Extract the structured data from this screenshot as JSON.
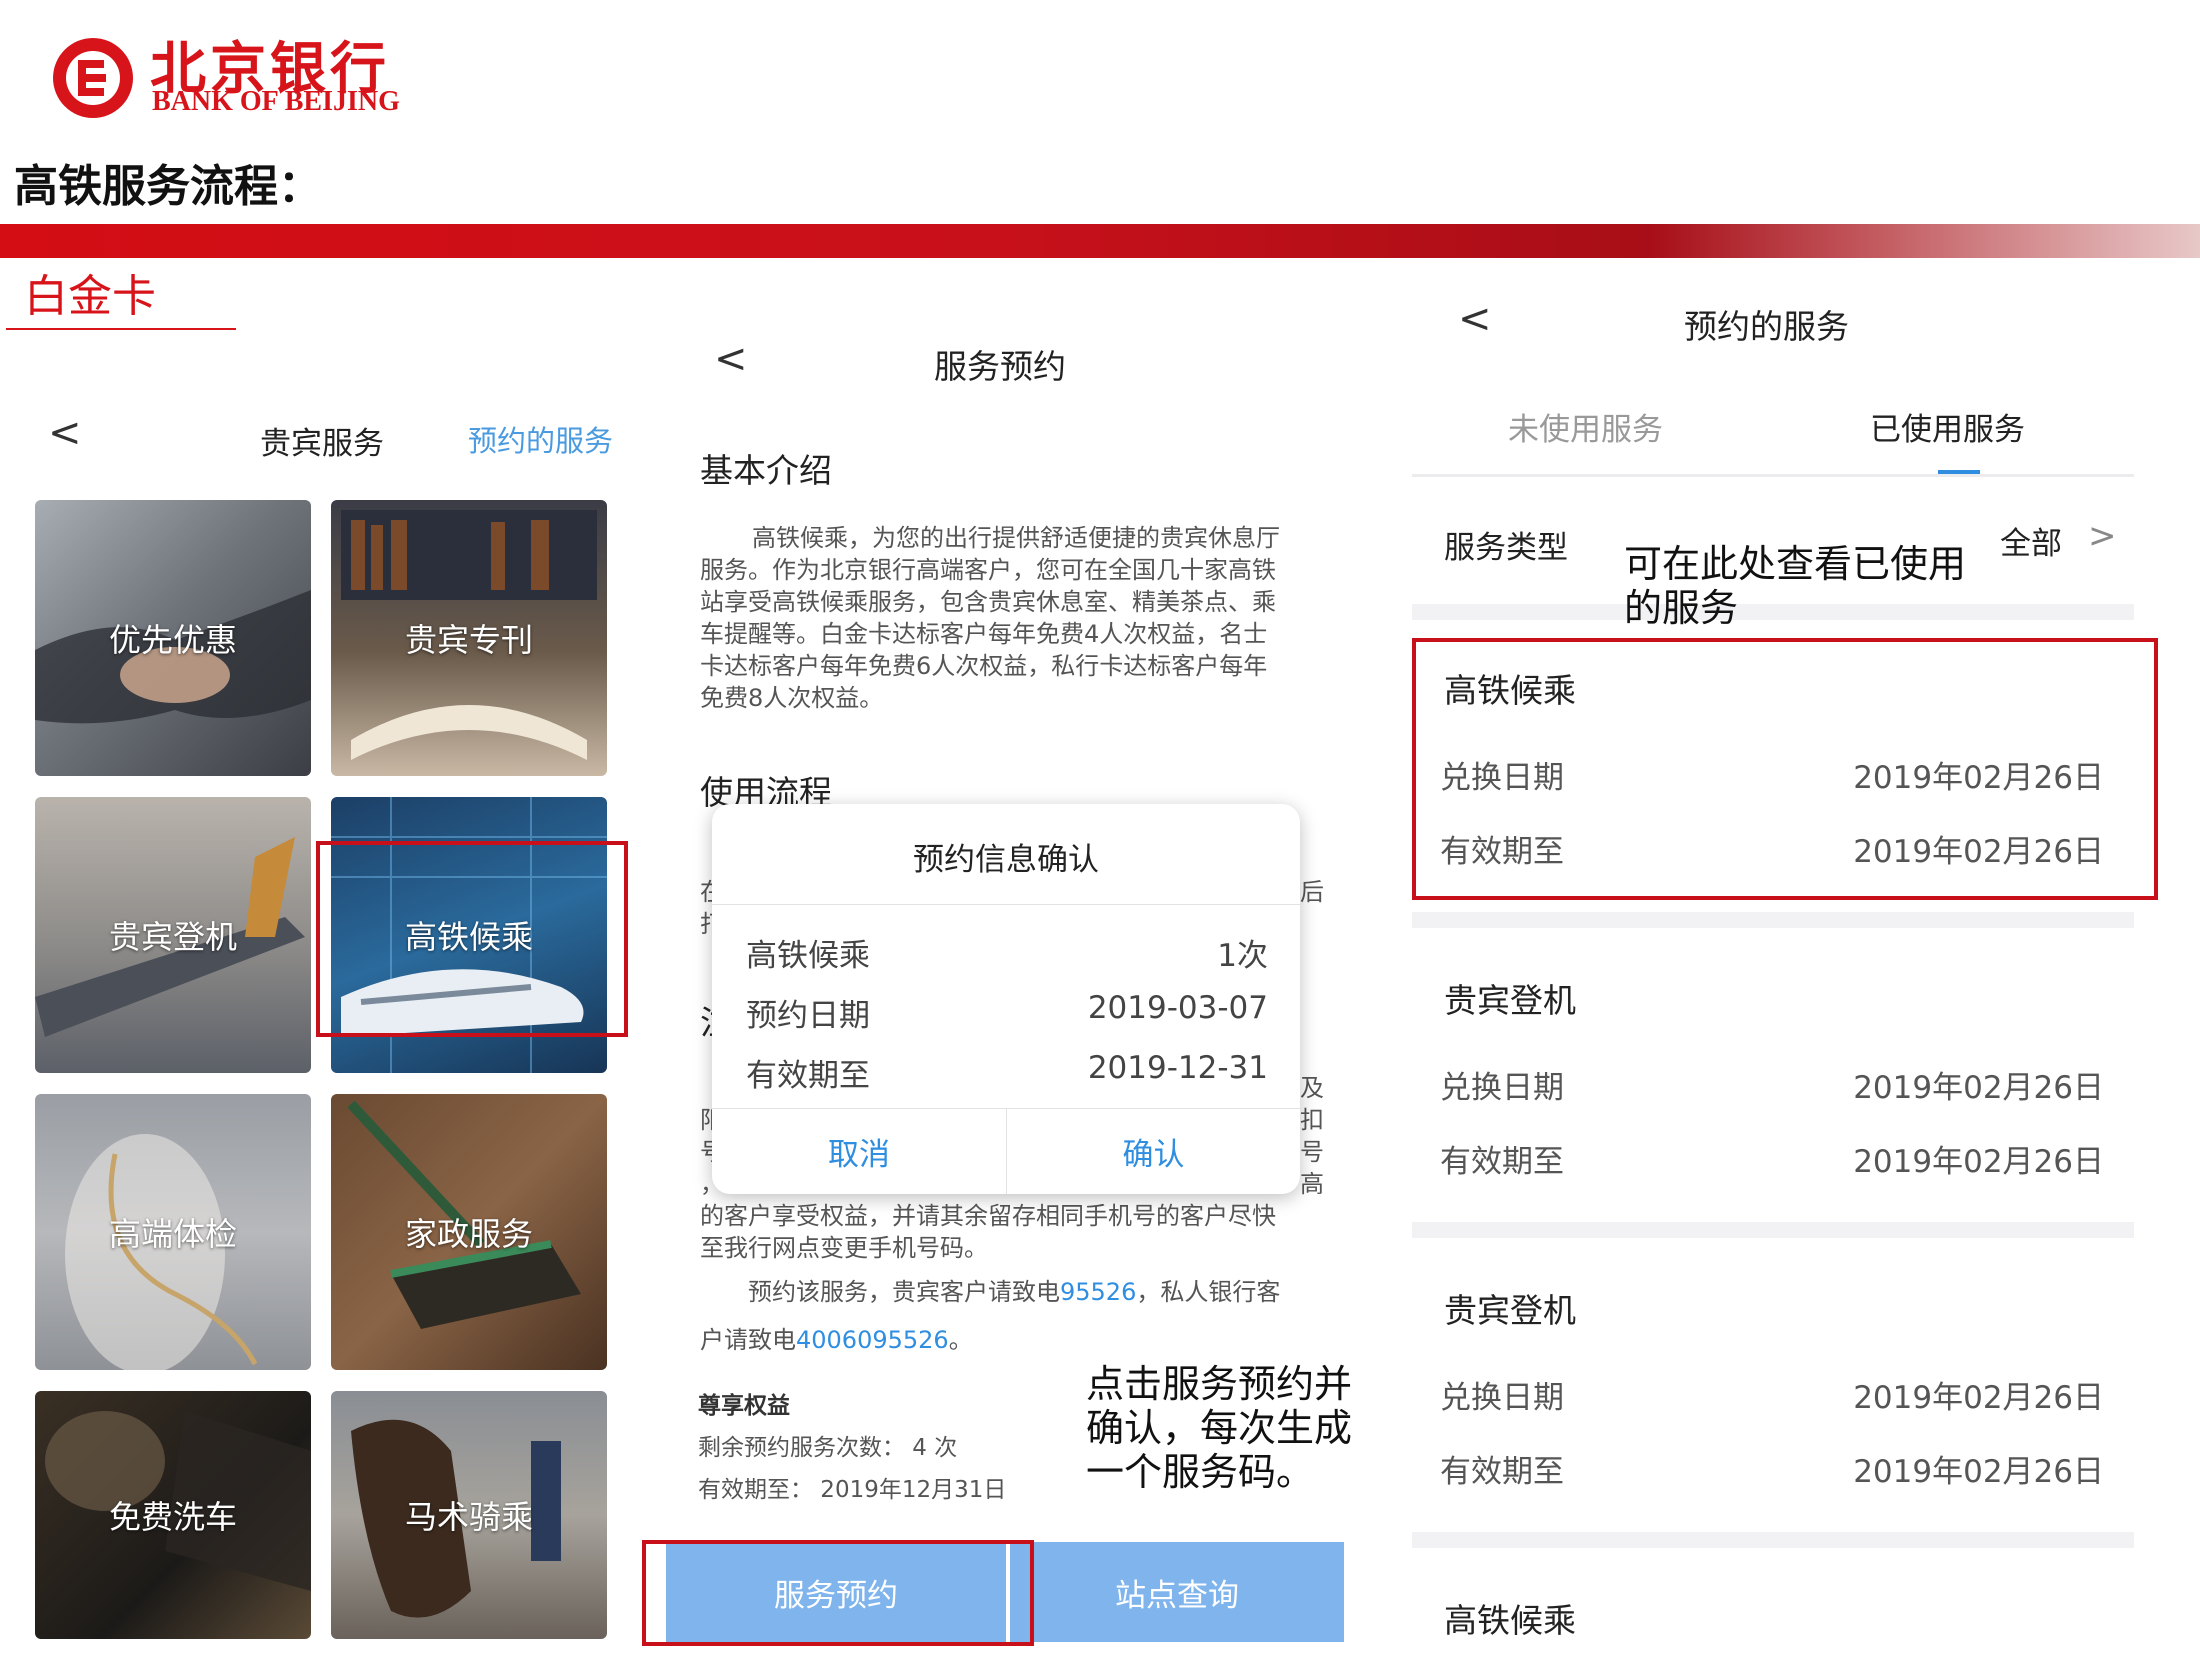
{
  "header": {
    "logo_cn": "北京银行",
    "logo_en": "BANK OF BEIJING",
    "page_title": "高铁服务流程：",
    "section_label": "白金卡"
  },
  "colors": {
    "brand_red": "#d8141b",
    "link_blue": "#2f8ee0",
    "button_blue": "#7fb4ec"
  },
  "panel1": {
    "nav": {
      "back_icon": "chevron-left-icon",
      "back": "<",
      "title": "贵宾服务",
      "right_link": "预约的服务"
    },
    "tiles": [
      "优先优惠",
      "贵宾专刊",
      "贵宾登机",
      "高铁候乘",
      "高端体检",
      "家政服务",
      "免费洗车",
      "马术骑乘"
    ]
  },
  "panel2": {
    "nav": {
      "back": "<",
      "title": "服务预约"
    },
    "intro_heading": "基本介绍",
    "intro_lines": [
      "高铁候乘，为您的出行提供舒适便捷的贵宾休息厅",
      "服务。作为北京银行高端客户，您可在全国几十家高铁",
      "站享受高铁候乘服务，包含贵宾休息室、精美茶点、乘",
      "车提醒等。白金卡达标客户每年免费4人次权益，名士",
      "卡达标客户每年免费6人次权益，私行卡达标客户每年",
      "免费8人次权益。"
    ],
    "process_heading": "使用流程",
    "obscured": {
      "line1": "在",
      "line1_end": "后",
      "line2": "打",
      "heading2": "注",
      "r1": "及",
      "r2": "扣",
      "r3": "号",
      "r4": "高",
      "l1": "阳",
      "l2": "号",
      "l3": "，"
    },
    "notice_lines": [
      "的客户享受权益，并请其余留存相同手机号的客户尽快",
      "至我行网点变更手机号码。"
    ],
    "booking_line1_prefix": "预约该服务，贵宾客户请致电",
    "booking_phone1": "95526",
    "booking_line1_suffix": "，私人银行客",
    "booking_line2_prefix": "户请致电",
    "booking_phone2": "4006095526",
    "booking_line2_suffix": "。",
    "rights_heading": "尊享权益",
    "remaining": "剩余预约服务次数：  4 次",
    "valid": "有效期至：  2019年12月31日",
    "btn_book": "服务预约",
    "btn_station": "站点查询",
    "dialog": {
      "title": "预约信息确认",
      "rows": [
        {
          "label": "高铁候乘",
          "value": "1次"
        },
        {
          "label": "预约日期",
          "value": "2019-03-07"
        },
        {
          "label": "有效期至",
          "value": "2019-12-31"
        }
      ],
      "cancel": "取消",
      "confirm": "确认"
    }
  },
  "panel3": {
    "nav": {
      "back": "<",
      "title": "预约的服务"
    },
    "tabs": {
      "unused": "未使用服务",
      "used": "已使用服务"
    },
    "filter_label": "服务类型",
    "filter_value": "全部",
    "filter_chevron": ">",
    "records": [
      {
        "title": "高铁候乘",
        "exchange_label": "兑换日期",
        "exchange": "2019年02月26日",
        "valid_label": "有效期至",
        "valid": "2019年02月26日"
      },
      {
        "title": "贵宾登机",
        "exchange_label": "兑换日期",
        "exchange": "2019年02月26日",
        "valid_label": "有效期至",
        "valid": "2019年02月26日"
      },
      {
        "title": "贵宾登机",
        "exchange_label": "兑换日期",
        "exchange": "2019年02月26日",
        "valid_label": "有效期至",
        "valid": "2019年02月26日"
      },
      {
        "title": "高铁候乘"
      }
    ]
  },
  "annotations": {
    "used_note_1": "可在此处查看已使用",
    "used_note_2": "的服务",
    "book_note_1": "点击服务预约并",
    "book_note_2": "确认，每次生成",
    "book_note_3": "一个服务码。"
  }
}
